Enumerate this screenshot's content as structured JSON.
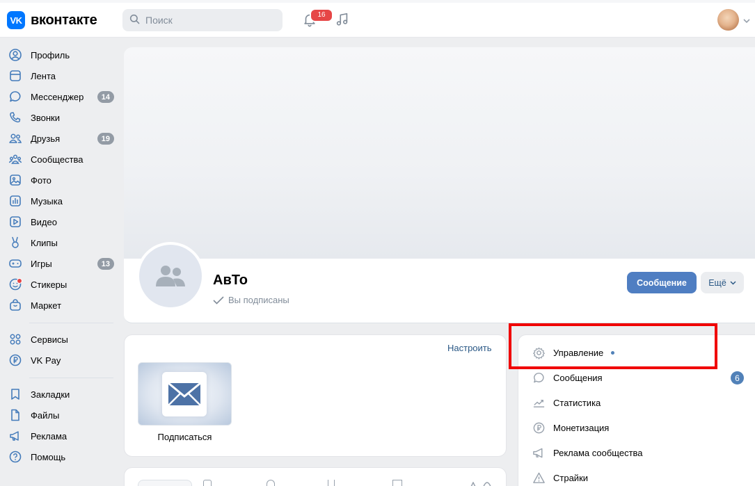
{
  "header": {
    "logo_text": "вконтакте",
    "logo_mark": "VK",
    "search_placeholder": "Поиск",
    "notifications_count": "16"
  },
  "sidebar": {
    "items": [
      {
        "label": "Профиль",
        "icon": "user-circle-icon"
      },
      {
        "label": "Лента",
        "icon": "newsfeed-icon"
      },
      {
        "label": "Мессенджер",
        "icon": "message-icon",
        "badge": "14"
      },
      {
        "label": "Звонки",
        "icon": "phone-icon"
      },
      {
        "label": "Друзья",
        "icon": "friends-icon",
        "badge": "19"
      },
      {
        "label": "Сообщества",
        "icon": "communities-icon"
      },
      {
        "label": "Фото",
        "icon": "photo-icon"
      },
      {
        "label": "Музыка",
        "icon": "music-icon"
      },
      {
        "label": "Видео",
        "icon": "video-icon"
      },
      {
        "label": "Клипы",
        "icon": "clips-icon"
      },
      {
        "label": "Игры",
        "icon": "games-icon",
        "badge": "13"
      },
      {
        "label": "Стикеры",
        "icon": "stickers-icon"
      },
      {
        "label": "Маркет",
        "icon": "market-icon"
      },
      {
        "label": "Сервисы",
        "icon": "services-icon"
      },
      {
        "label": "VK Pay",
        "icon": "vkpay-icon"
      },
      {
        "label": "Закладки",
        "icon": "bookmark-icon"
      },
      {
        "label": "Файлы",
        "icon": "file-icon"
      },
      {
        "label": "Реклама",
        "icon": "ads-icon"
      },
      {
        "label": "Помощь",
        "icon": "help-icon"
      }
    ]
  },
  "group": {
    "name": "АвТо",
    "status": "Вы подписаны",
    "message_button": "Сообщение",
    "more_button": "Ещё"
  },
  "widget": {
    "configure_label": "Настроить",
    "subscribe_label": "Подписаться"
  },
  "manage_menu": {
    "items": [
      {
        "label": "Управление",
        "icon": "gear-icon"
      },
      {
        "label": "Сообщения",
        "icon": "message-icon",
        "badge": "6"
      },
      {
        "label": "Статистика",
        "icon": "stats-icon"
      },
      {
        "label": "Монетизация",
        "icon": "ruble-icon"
      },
      {
        "label": "Реклама сообщества",
        "icon": "megaphone-icon"
      },
      {
        "label": "Страйки",
        "icon": "warning-icon"
      }
    ]
  },
  "colors": {
    "accent": "#4f7ec2",
    "logo": "#0077ff",
    "highlight": "#f00000",
    "badge_red": "#e64646"
  }
}
